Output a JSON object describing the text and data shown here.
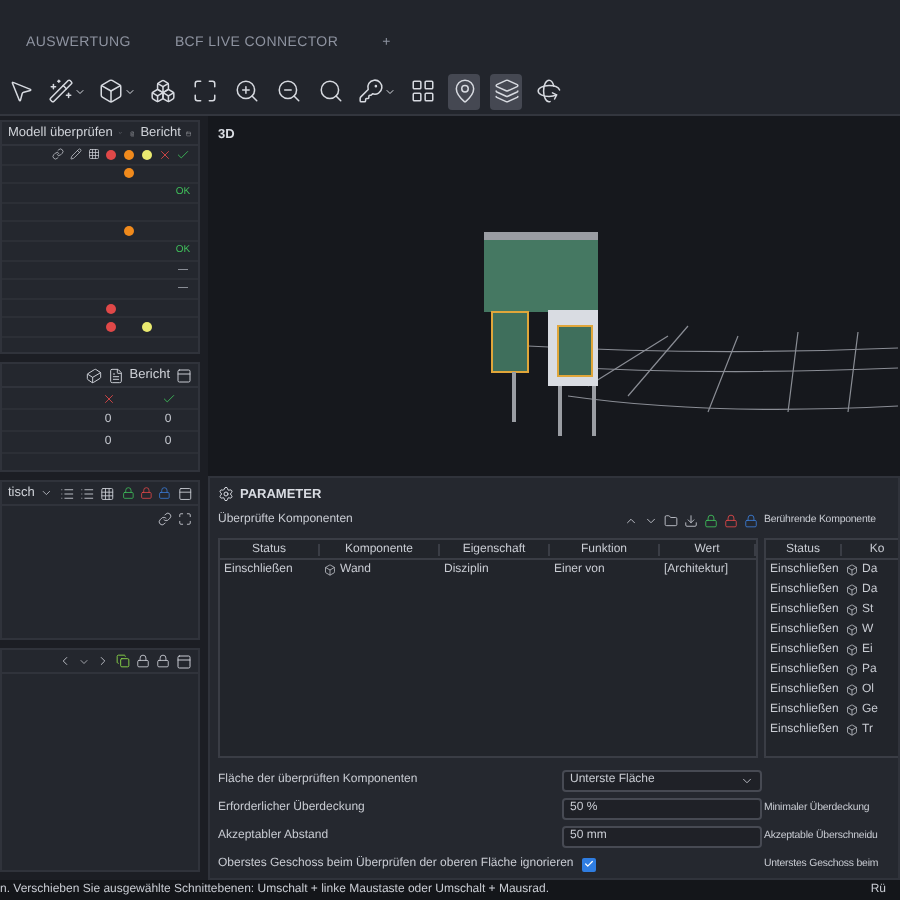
{
  "tabs": [
    {
      "label": "AUSWERTUNG",
      "selected": false
    },
    {
      "label": "BCF LIVE CONNECTOR",
      "selected": false
    }
  ],
  "add_tab": "+",
  "check_panel": {
    "title": "Modell überprüfen",
    "report": "Bericht",
    "rows": [
      {
        "red": false,
        "orange": true,
        "yellow": false,
        "result": ""
      },
      {
        "red": false,
        "orange": false,
        "yellow": false,
        "result": "OK"
      },
      {
        "red": false,
        "orange": false,
        "yellow": false,
        "result": ""
      },
      {
        "red": false,
        "orange": true,
        "yellow": false,
        "result": ""
      },
      {
        "red": false,
        "orange": false,
        "yellow": false,
        "result": "OK"
      },
      {
        "red": false,
        "orange": false,
        "yellow": false,
        "result": "—"
      },
      {
        "red": false,
        "orange": false,
        "yellow": false,
        "result": "—"
      },
      {
        "red": true,
        "orange": false,
        "yellow": false,
        "result": ""
      },
      {
        "red": true,
        "orange": false,
        "yellow": true,
        "result": ""
      }
    ]
  },
  "summary_panel": {
    "report": "Bericht",
    "rows": [
      [
        "0",
        "0"
      ],
      [
        "0",
        "0"
      ]
    ]
  },
  "filter_panel": {
    "title": "tisch"
  },
  "viewer": {
    "label": "3D"
  },
  "parameters": {
    "title": "PARAMETER",
    "checked_components": {
      "title": "Überprüfte Komponenten",
      "columns": [
        "Status",
        "Komponente",
        "Eigenschaft",
        "Funktion",
        "Wert"
      ],
      "rows": [
        [
          "Einschließen",
          "Wand",
          "Disziplin",
          "Einer von",
          "[Architektur]"
        ]
      ]
    },
    "touching_components": {
      "title": "Berührende Komponente",
      "columns": [
        "Status",
        "Ko"
      ],
      "rows": [
        [
          "Einschließen",
          "Da"
        ],
        [
          "Einschließen",
          "Da"
        ],
        [
          "Einschließen",
          "St"
        ],
        [
          "Einschließen",
          "W"
        ],
        [
          "Einschließen",
          "Ei"
        ],
        [
          "Einschließen",
          "Pa"
        ],
        [
          "Einschließen",
          "Ol"
        ],
        [
          "Einschließen",
          "Ge"
        ],
        [
          "Einschließen",
          "Tr"
        ]
      ]
    },
    "settings": [
      {
        "kind": "select",
        "label": "Fläche der überprüften Komponenten",
        "value": "Unterste Fläche"
      },
      {
        "kind": "input",
        "label": "Erforderlicher Überdeckung",
        "value": "50 %"
      },
      {
        "kind": "input",
        "label": "Akzeptabler Abstand",
        "value": "50 mm"
      },
      {
        "kind": "checkbox",
        "label": "Oberstes Geschoss beim Überprüfen der oberen Fläche ignorieren",
        "checked": true
      }
    ],
    "right_settings": [
      "Minimaler Überdeckung",
      "Akzeptable Überschneidu",
      "Unterstes Geschoss beim"
    ]
  },
  "status_bar": {
    "message": "n. Verschieben Sie ausgewählte Schnittebenen: Umschalt + linke Maustaste oder Umschalt + Mausrad.",
    "right": "Rü"
  }
}
